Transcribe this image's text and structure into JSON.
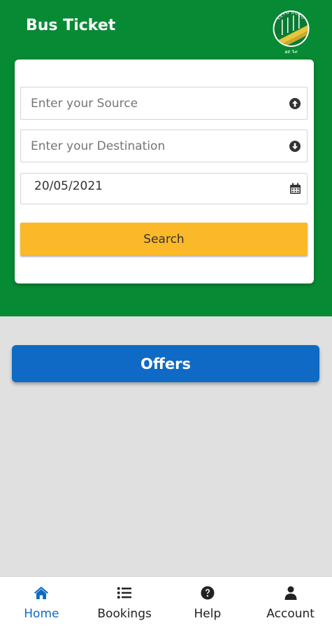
{
  "header": {
    "title": "Bus Ticket",
    "logo": {
      "top_text": "LEYU BUZO",
      "bottom_text": "ልዩ ጉዞ"
    }
  },
  "form": {
    "source": {
      "value": "",
      "placeholder": "Enter your Source",
      "icon": "arrow-circle-up-icon"
    },
    "destination": {
      "value": "",
      "placeholder": "Enter your Destination",
      "icon": "arrow-circle-down-icon"
    },
    "date": {
      "value": "20/05/2021",
      "icon": "calendar-icon"
    },
    "search_label": "Search"
  },
  "offers_label": "Offers",
  "nav": [
    {
      "label": "Home",
      "icon": "home-icon",
      "active": true
    },
    {
      "label": "Bookings",
      "icon": "list-icon",
      "active": false
    },
    {
      "label": "Help",
      "icon": "help-circle-icon",
      "active": false
    },
    {
      "label": "Account",
      "icon": "user-icon",
      "active": false
    }
  ],
  "colors": {
    "header_green": "#078a34",
    "search_yellow": "#fbb829",
    "offers_blue": "#0e6ac4",
    "background": "#e0e0e0"
  }
}
